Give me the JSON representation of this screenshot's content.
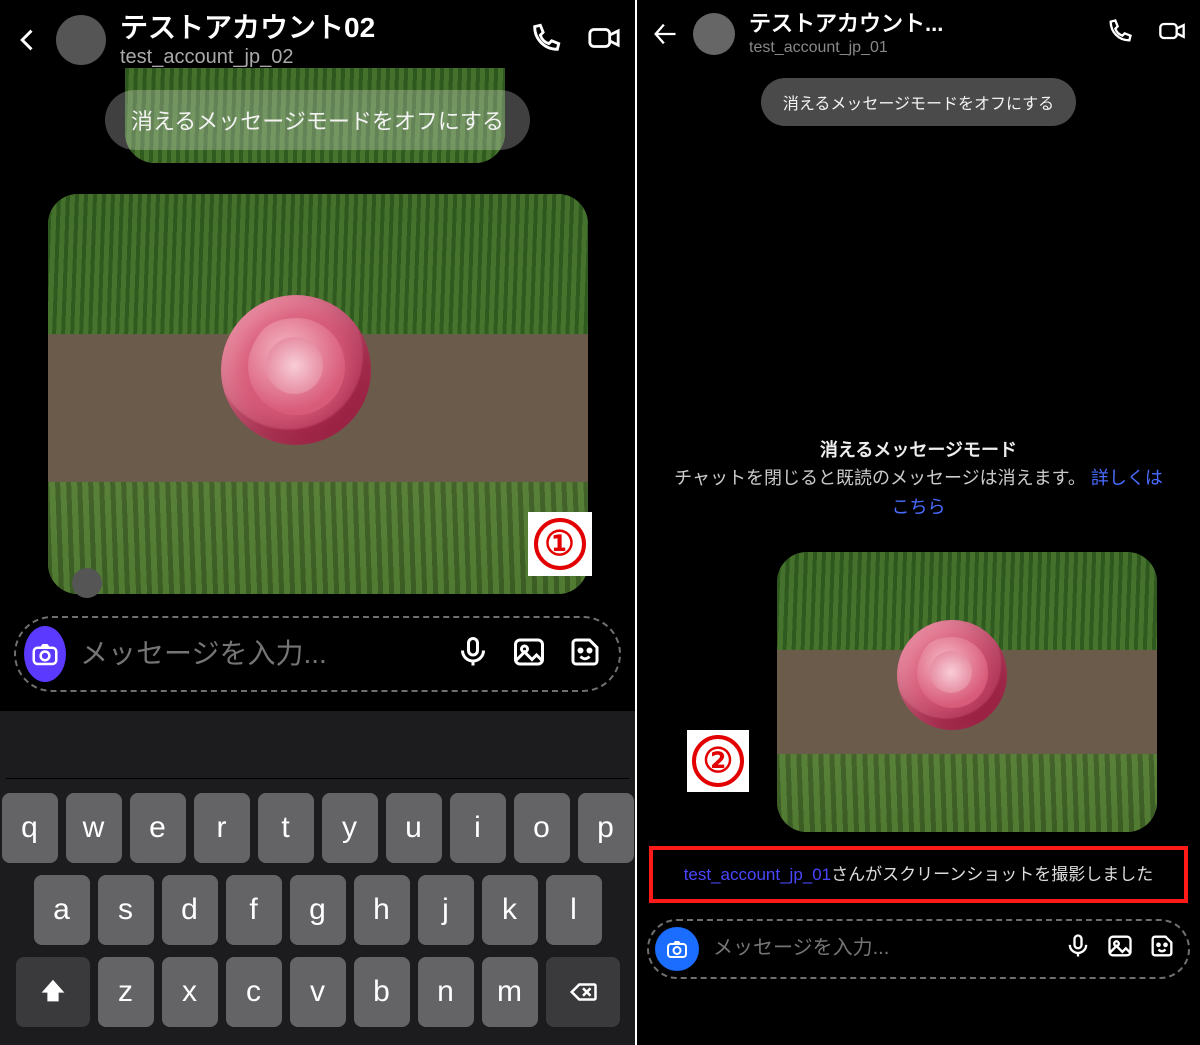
{
  "left": {
    "header": {
      "title": "テストアカウント02",
      "handle": "test_account_jp_02"
    },
    "pill": "消えるメッセージモードをオフにする",
    "badge": "①",
    "composer": {
      "placeholder": "メッセージを入力..."
    },
    "keyboard": {
      "rows": [
        [
          "q",
          "w",
          "e",
          "r",
          "t",
          "y",
          "u",
          "i",
          "o",
          "p"
        ],
        [
          "a",
          "s",
          "d",
          "f",
          "g",
          "h",
          "j",
          "k",
          "l"
        ],
        [
          "z",
          "x",
          "c",
          "v",
          "b",
          "n",
          "m"
        ]
      ]
    }
  },
  "right": {
    "header": {
      "title": "テストアカウント...",
      "handle": "test_account_jp_01"
    },
    "pill": "消えるメッセージモードをオフにする",
    "info": {
      "title": "消えるメッセージモード",
      "body": "チャットを閉じると既読のメッセージは消えます。",
      "link": "詳しくはこちら"
    },
    "badge": "②",
    "notice": {
      "user": "test_account_jp_01",
      "text": "さんがスクリーンショットを撮影しました"
    },
    "composer": {
      "placeholder": "メッセージを入力..."
    }
  }
}
